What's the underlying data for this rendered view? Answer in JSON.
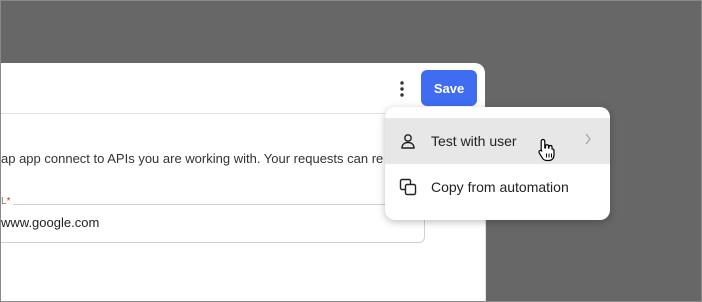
{
  "toolbar": {
    "save_label": "Save",
    "more_icon": "more-vertical-icon"
  },
  "description": "ap app connect to APIs you are working with. Your requests can re",
  "field": {
    "label": "L",
    "required_mark": "*",
    "value": "www.google.com"
  },
  "menu": {
    "items": [
      {
        "label": "Test with user",
        "icon": "user-icon",
        "has_submenu": true
      },
      {
        "label": "Copy from automation",
        "icon": "copy-icon",
        "has_submenu": false
      }
    ]
  },
  "colors": {
    "accent": "#3f6cf0",
    "overlay": "#676767",
    "hover": "#e7e7e7",
    "required": "#d4380d"
  }
}
